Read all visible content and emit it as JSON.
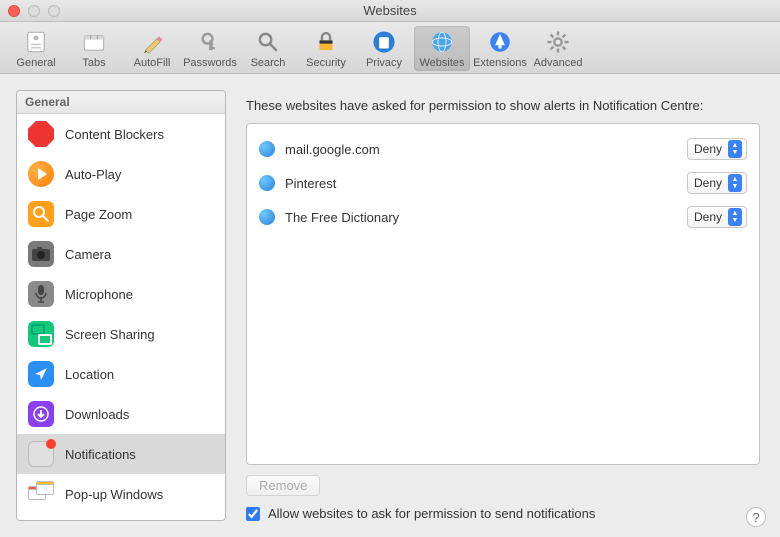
{
  "window": {
    "title": "Websites"
  },
  "toolbar": {
    "items": [
      {
        "id": "general",
        "label": "General"
      },
      {
        "id": "tabs",
        "label": "Tabs"
      },
      {
        "id": "autofill",
        "label": "AutoFill"
      },
      {
        "id": "passwords",
        "label": "Passwords"
      },
      {
        "id": "search",
        "label": "Search"
      },
      {
        "id": "security",
        "label": "Security"
      },
      {
        "id": "privacy",
        "label": "Privacy"
      },
      {
        "id": "websites",
        "label": "Websites"
      },
      {
        "id": "extensions",
        "label": "Extensions"
      },
      {
        "id": "advanced",
        "label": "Advanced"
      }
    ],
    "active": "websites"
  },
  "sidebar": {
    "header": "General",
    "items": [
      {
        "id": "content-blockers",
        "label": "Content Blockers"
      },
      {
        "id": "auto-play",
        "label": "Auto-Play"
      },
      {
        "id": "page-zoom",
        "label": "Page Zoom"
      },
      {
        "id": "camera",
        "label": "Camera"
      },
      {
        "id": "microphone",
        "label": "Microphone"
      },
      {
        "id": "screen-sharing",
        "label": "Screen Sharing"
      },
      {
        "id": "location",
        "label": "Location"
      },
      {
        "id": "downloads",
        "label": "Downloads"
      },
      {
        "id": "notifications",
        "label": "Notifications"
      },
      {
        "id": "popup-windows",
        "label": "Pop-up Windows"
      }
    ],
    "selected": "notifications"
  },
  "main": {
    "heading": "These websites have asked for permission to show alerts in Notification Centre:",
    "sites": [
      {
        "name": "mail.google.com",
        "permission": "Deny"
      },
      {
        "name": "Pinterest",
        "permission": "Deny"
      },
      {
        "name": "The Free Dictionary",
        "permission": "Deny"
      }
    ],
    "remove_label": "Remove",
    "remove_enabled": false,
    "allow_checkbox": {
      "checked": true,
      "label": "Allow websites to ask for permission to send notifications"
    }
  },
  "help_label": "?"
}
